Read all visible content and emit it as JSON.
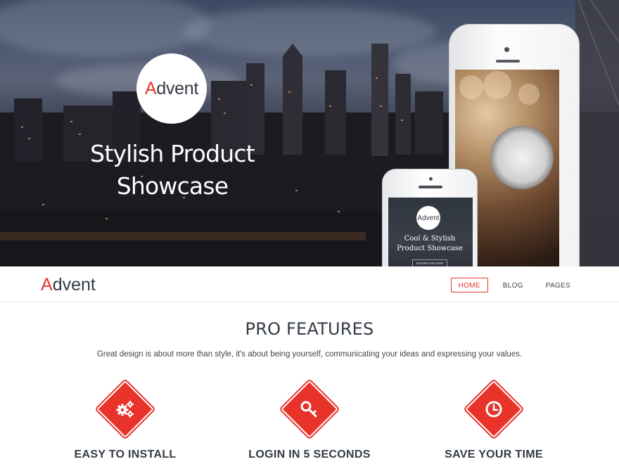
{
  "hero": {
    "logo_initial": "A",
    "logo_rest": "dvent",
    "title_line1": "Stylish Product",
    "title_line2": "Showcase",
    "phone": {
      "logo_text": "Advent",
      "title_line1": "Cool & Stylish",
      "title_line2": "Product Showcase",
      "button_label": "DOWNLOAD NOW"
    }
  },
  "navbar": {
    "brand_initial": "A",
    "brand_rest": "dvent",
    "menu": [
      {
        "label": "HOME",
        "active": true
      },
      {
        "label": "BLOG",
        "active": false
      },
      {
        "label": "PAGES",
        "active": false
      }
    ]
  },
  "features": {
    "title": "PRO FEATURES",
    "subtitle": "Great design is about more than style, it's about being yourself, communicating your ideas and expressing your values.",
    "items": [
      {
        "icon": "gears-icon",
        "label": "EASY TO INSTALL"
      },
      {
        "icon": "key-icon",
        "label": "LOGIN IN 5 SECONDS"
      },
      {
        "icon": "clock-icon",
        "label": "SAVE YOUR TIME"
      }
    ]
  },
  "colors": {
    "accent": "#e8332b",
    "text_dark": "#333a44"
  }
}
